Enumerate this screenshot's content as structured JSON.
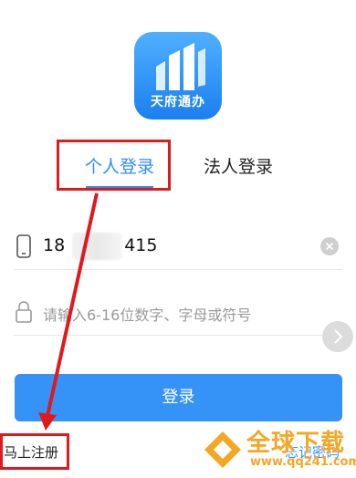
{
  "app": {
    "logo_text": "天府通办"
  },
  "tabs": [
    {
      "label": "个人登录",
      "active": true
    },
    {
      "label": "法人登录",
      "active": false
    }
  ],
  "phone": {
    "value_prefix": "18",
    "value_suffix": "415"
  },
  "password": {
    "placeholder": "请输入6-16位数字、字母或符号"
  },
  "login_button": {
    "label": "登录"
  },
  "links": {
    "register": "马上注册",
    "forgot": "忘记密码"
  },
  "watermark": {
    "text": "全球下载",
    "url": "www.qq241.com"
  },
  "colors": {
    "accent": "#3592f6",
    "annotation": "#e0191c",
    "watermark": "#f5a623"
  },
  "icons": [
    "phone-icon",
    "lock-icon",
    "clear-icon",
    "chevron-right-icon"
  ]
}
